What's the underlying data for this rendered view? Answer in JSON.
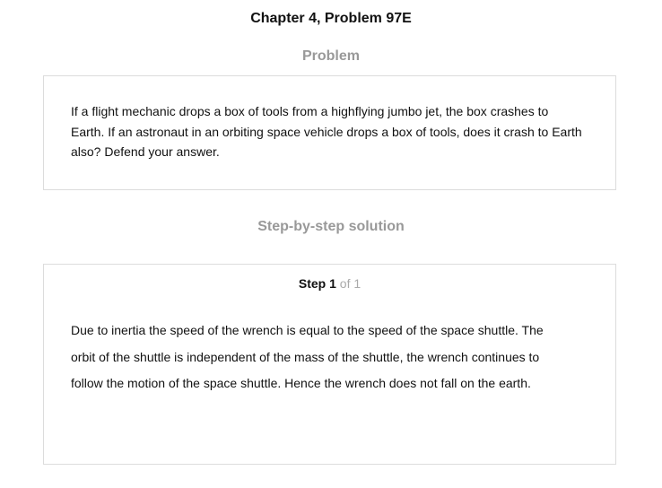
{
  "page": {
    "title": "Chapter 4, Problem 97E"
  },
  "problem": {
    "heading": "Problem",
    "text": "If a flight mechanic drops a box of tools from a highflying jumbo jet, the box crashes to Earth. If an astronaut in an orbiting space vehicle drops a box of tools, does it crash to Earth also? Defend your answer."
  },
  "solution": {
    "heading": "Step-by-step solution",
    "step": {
      "word": "Step",
      "current": "1",
      "of_text": "of 1"
    },
    "text": "Due to inertia the speed of the wrench is equal to the speed of the space shuttle. The orbit of the shuttle is independent of the mass of the shuttle, the wrench continues to follow the motion of the space shuttle. Hence the wrench does not fall on the earth."
  },
  "colors": {
    "heading_gray": "#999999",
    "border_gray": "#dcdcdc",
    "muted_gray": "#aaaaaa",
    "text": "#111111"
  }
}
